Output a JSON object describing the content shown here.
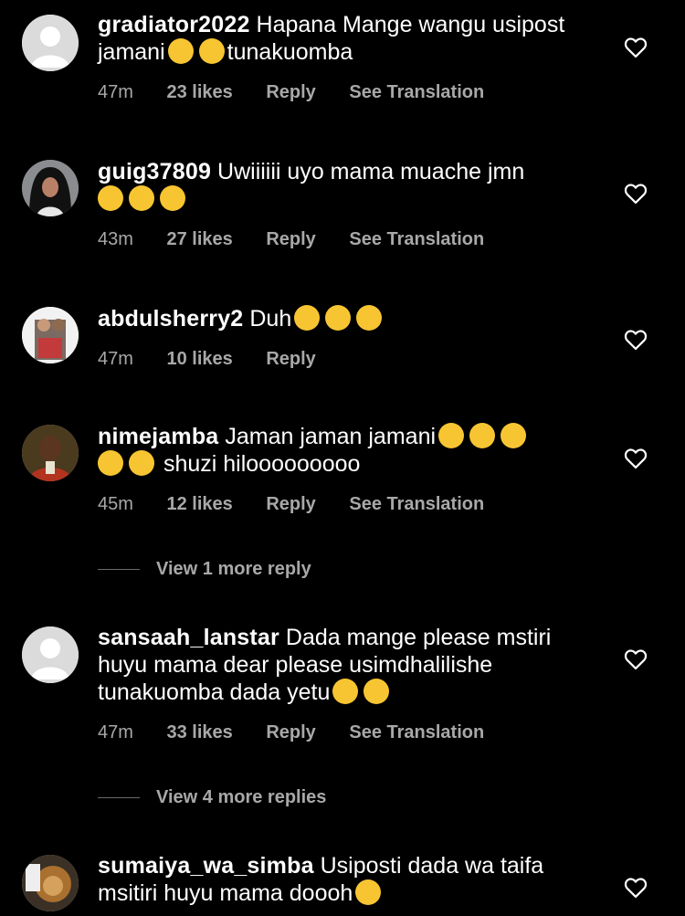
{
  "comments": [
    {
      "username": "gradiator2022",
      "text": "Hapana Mange wangu usipost jamani",
      "text_after": "tunakuomba",
      "emojis": [
        "crying-face",
        "crying-face"
      ],
      "time": "47m",
      "likes": "23 likes",
      "reply": "Reply",
      "translation": "See Translation",
      "avatar": "default-avatar"
    },
    {
      "username": "guig37809",
      "text": "Uwiiiiii uyo mama muache jmn",
      "emojis": [
        "crying-face",
        "crying-face",
        "crying-face"
      ],
      "time": "43m",
      "likes": "27 likes",
      "reply": "Reply",
      "translation": "See Translation",
      "avatar": "hijab-profile-photo"
    },
    {
      "username": "abdulsherry2",
      "text": "Duh",
      "emojis": [
        "astonished-face",
        "astonished-face",
        "astonished-face"
      ],
      "time": "47m",
      "likes": "10 likes",
      "reply": "Reply",
      "avatar": "group-profile-photo"
    },
    {
      "username": "nimejamba",
      "text": "Jaman jaman jamani",
      "text_after": "shuzi hilooooooooo",
      "emojis": [
        "tears-of-joy-face",
        "tears-of-joy-face",
        "tears-of-joy-face",
        "tears-of-joy-face",
        "tears-of-joy-face"
      ],
      "time": "45m",
      "likes": "12 likes",
      "reply": "Reply",
      "translation": "See Translation",
      "view_more": "View 1 more reply",
      "avatar": "portrait-painting"
    },
    {
      "username": "sansaah_lanstar",
      "text": "Dada mange please mstiri huyu mama dear please usimdhalilishe tunakuomba dada yetu",
      "emojis": [
        "clapping-hands",
        "crying-face"
      ],
      "time": "47m",
      "likes": "33 likes",
      "reply": "Reply",
      "translation": "See Translation",
      "view_more": "View 4 more replies",
      "avatar": "default-avatar"
    },
    {
      "username": "sumaiya_wa_simba",
      "text": "Usiposti dada wa taifa msitiri huyu mama doooh",
      "emojis": [
        "crying-face"
      ],
      "avatar": "lion-photo"
    }
  ],
  "colors": {
    "background": "#000000",
    "text": "#ffffff",
    "meta": "#a8a8a8",
    "emoji": "#f7c531"
  }
}
